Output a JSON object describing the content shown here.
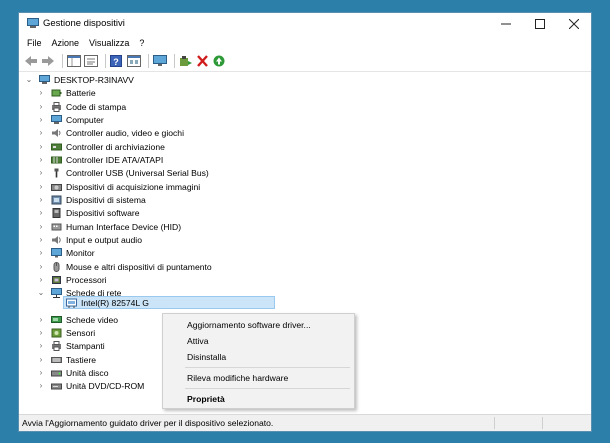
{
  "window": {
    "title": "Gestione dispositivi"
  },
  "menubar": {
    "items": [
      "File",
      "Azione",
      "Visualizza",
      "?"
    ]
  },
  "toolbar": {
    "buttons": [
      "back-arrow-icon",
      "forward-arrow-icon",
      "properties-icon",
      "list-icon",
      "help-icon",
      "details-icon",
      "monitor-scan-icon",
      "add-driver-icon",
      "remove-icon",
      "update-icon"
    ],
    "colors": {
      "remove": "#d01c1c",
      "update": "#2e9a37"
    }
  },
  "tree": {
    "root": "DESKTOP-R3INAVV",
    "categories": [
      {
        "label": "Batterie",
        "icon": "battery-icon"
      },
      {
        "label": "Code di stampa",
        "icon": "printer-queue-icon"
      },
      {
        "label": "Computer",
        "icon": "computer-icon"
      },
      {
        "label": "Controller audio, video e giochi",
        "icon": "speaker-icon"
      },
      {
        "label": "Controller di archiviazione",
        "icon": "storage-controller-icon"
      },
      {
        "label": "Controller IDE ATA/ATAPI",
        "icon": "ide-controller-icon"
      },
      {
        "label": "Controller USB (Universal Serial Bus)",
        "icon": "usb-icon"
      },
      {
        "label": "Dispositivi di acquisizione immagini",
        "icon": "camera-icon"
      },
      {
        "label": "Dispositivi di sistema",
        "icon": "system-device-icon"
      },
      {
        "label": "Dispositivi software",
        "icon": "software-device-icon"
      },
      {
        "label": "Human Interface Device (HID)",
        "icon": "hid-icon"
      },
      {
        "label": "Input e output audio",
        "icon": "audio-io-icon"
      },
      {
        "label": "Monitor",
        "icon": "monitor-icon"
      },
      {
        "label": "Mouse e altri dispositivi di puntamento",
        "icon": "mouse-icon"
      },
      {
        "label": "Processori",
        "icon": "processor-icon"
      },
      {
        "label": "Schede di rete",
        "icon": "network-adapter-icon"
      },
      {
        "label": "Schede video",
        "icon": "display-adapter-icon"
      },
      {
        "label": "Sensori",
        "icon": "sensor-icon"
      },
      {
        "label": "Stampanti",
        "icon": "printer-icon"
      },
      {
        "label": "Tastiere",
        "icon": "keyboard-icon"
      },
      {
        "label": "Unità disco",
        "icon": "disk-drive-icon"
      },
      {
        "label": "Unità DVD/CD-ROM",
        "icon": "dvd-drive-icon"
      }
    ],
    "selected_child": "Intel(R) 82574L G"
  },
  "context_menu": {
    "update": "Aggiornamento software driver...",
    "enable": "Attiva",
    "uninstall": "Disinstalla",
    "scan": "Rileva modifiche hardware",
    "properties": "Proprietà"
  },
  "status": {
    "text": "Avvia l'Aggiornamento guidato driver per il dispositivo selezionato."
  }
}
